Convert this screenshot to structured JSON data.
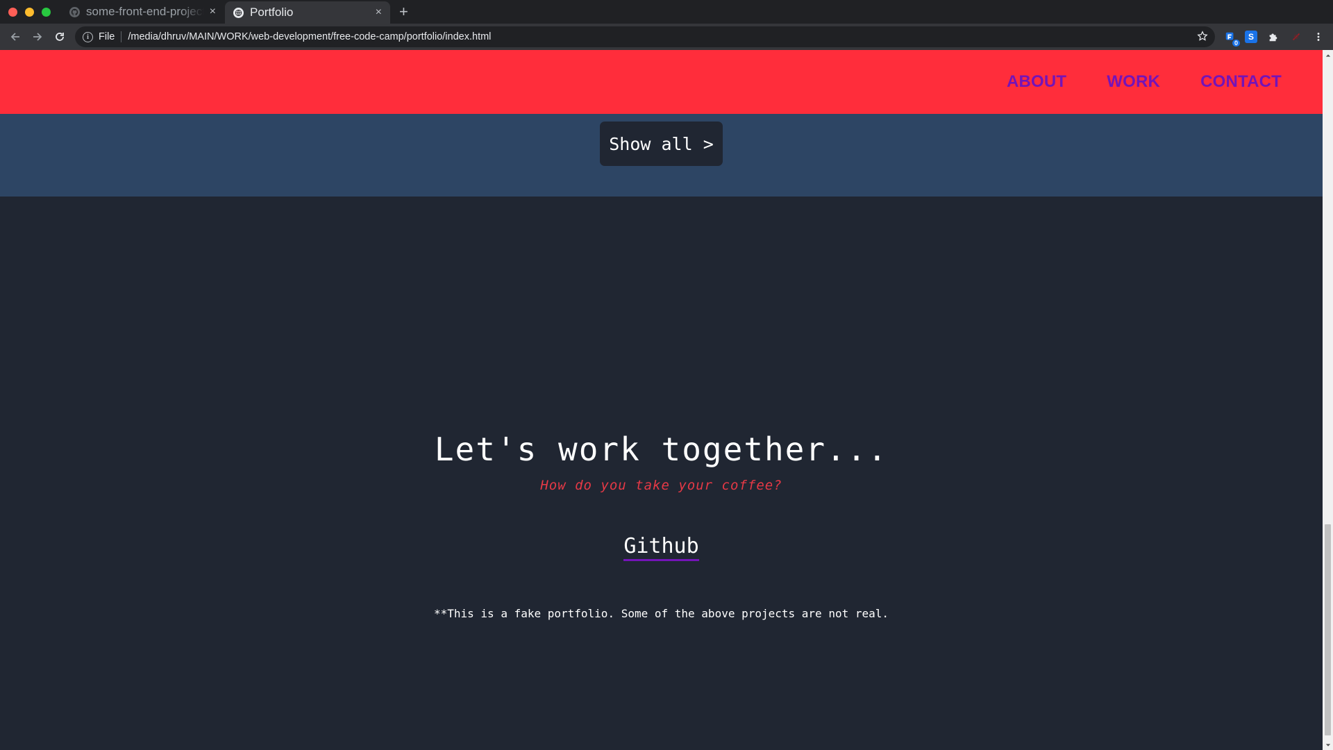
{
  "browser": {
    "tabs": [
      {
        "title": "some-front-end-projects",
        "icon": "github-icon",
        "active": false
      },
      {
        "title": "Portfolio",
        "icon": "globe-icon",
        "active": true
      }
    ],
    "new_tab_label": "+",
    "close_label": "×",
    "address": {
      "scheme_label": "File",
      "url": "/media/dhruv/MAIN/WORK/web-development/free-code-camp/portfolio/index.html"
    },
    "extensions": {
      "badge_count": "0",
      "s_label": "S"
    }
  },
  "site": {
    "nav": {
      "links": [
        "ABOUT",
        "WORK",
        "CONTACT"
      ]
    },
    "work": {
      "show_all_label": "Show all >"
    },
    "contact": {
      "heading": "Let's work together...",
      "subheading": "How do you take your coffee?",
      "github_label": "Github",
      "disclaimer": "**This is a fake portfolio. Some of the above projects are not real."
    }
  },
  "colors": {
    "nav_bg": "#ff2d3b",
    "nav_link": "#7414b8",
    "work_bg": "#2d4564",
    "page_bg": "#202632",
    "accent_red": "#e63946"
  }
}
